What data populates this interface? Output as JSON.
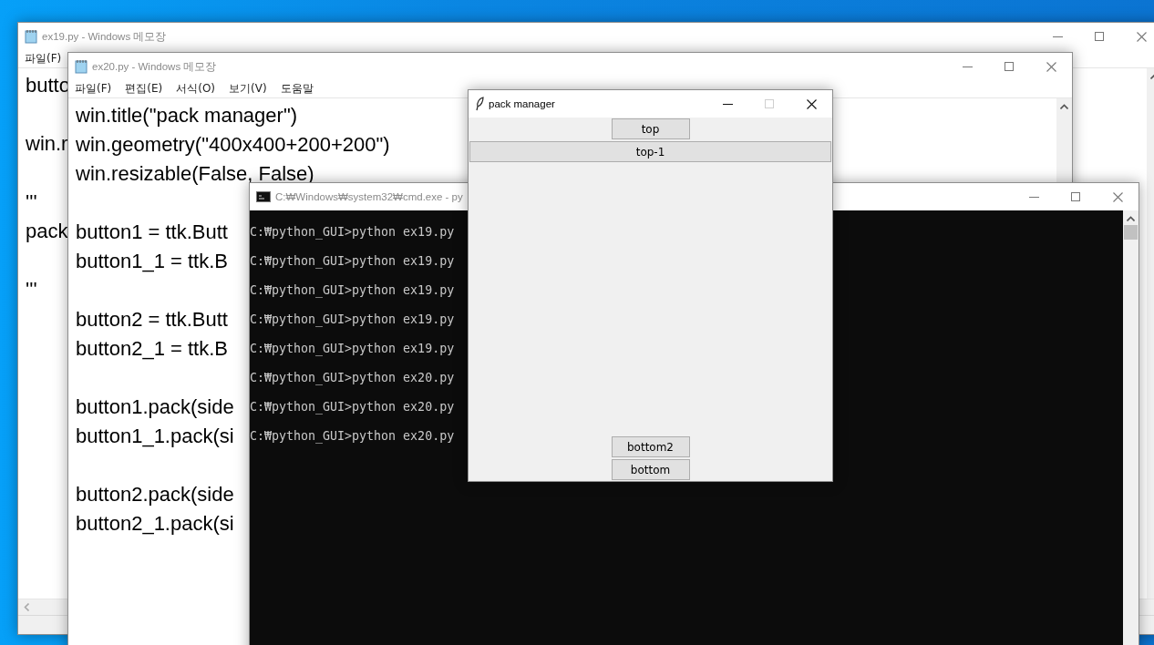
{
  "windows": [
    {
      "kind": "notepad",
      "title": "ex19.py - Windows 메모장",
      "active": false,
      "maximize_disabled": false,
      "menu": [
        "파일(F)"
      ],
      "paragraphs": [
        [
          "butto"
        ],
        [
          "win.r"
        ],
        [
          "'''",
          "pack"
        ],
        [
          "'''"
        ]
      ]
    },
    {
      "kind": "notepad",
      "title": "ex20.py - Windows 메모장",
      "active": false,
      "maximize_disabled": false,
      "menu": [
        "파일(F)",
        "편집(E)",
        "서식(O)",
        "보기(V)",
        "도움말"
      ],
      "paragraphs": [
        [
          "win.title(\"pack manager\")",
          "win.geometry(\"400x400+200+200\")",
          "win.resizable(False, False)"
        ],
        [
          "button1 = ttk.Butt",
          "button1_1 = ttk.B"
        ],
        [
          "button2 = ttk.Butt",
          "button2_1 = ttk.B"
        ],
        [
          "button1.pack(side",
          "button1_1.pack(si"
        ],
        [
          "button2.pack(side",
          "button2_1.pack(si"
        ]
      ]
    },
    {
      "kind": "console",
      "title": "C:₩Windows₩system32₩cmd.exe - py",
      "active": false,
      "maximize_disabled": false,
      "lines": [
        "C:₩python_GUI>python ex19.py",
        "C:₩python_GUI>python ex19.py",
        "C:₩python_GUI>python ex19.py",
        "C:₩python_GUI>python ex19.py",
        "C:₩python_GUI>python ex19.py",
        "C:₩python_GUI>python ex20.py",
        "C:₩python_GUI>python ex20.py",
        "C:₩python_GUI>python ex20.py"
      ]
    },
    {
      "kind": "tk",
      "title": "pack manager",
      "active": true,
      "maximize_disabled": true,
      "buttons": [
        {
          "label": "top",
          "kind": "top",
          "fill": false
        },
        {
          "label": "top-1",
          "kind": "top",
          "fill": true
        },
        {
          "label": "bottom2",
          "kind": "bottom",
          "fill": false
        },
        {
          "label": "bottom",
          "kind": "bottom",
          "fill": false
        }
      ]
    }
  ]
}
